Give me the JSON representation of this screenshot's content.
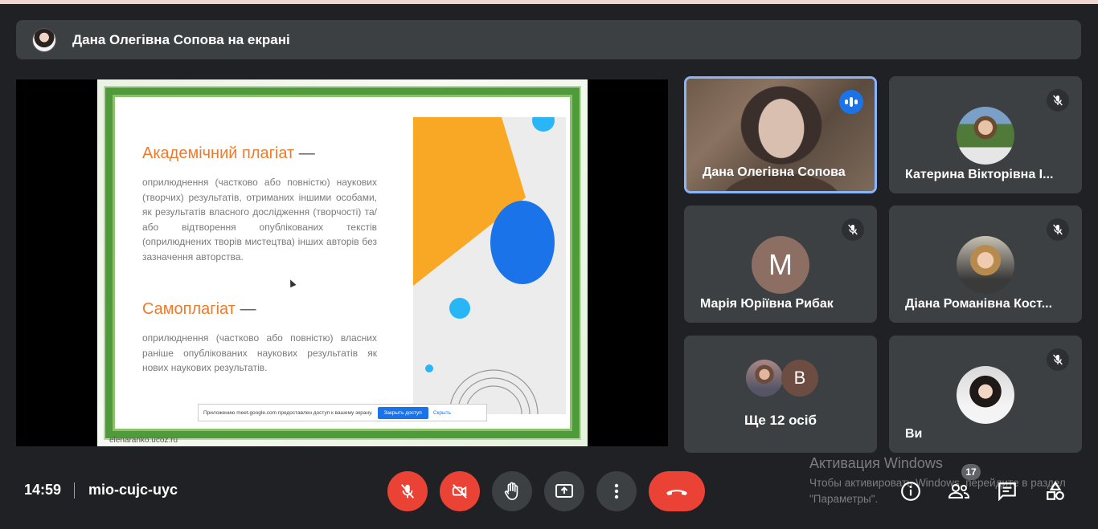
{
  "banner": {
    "title": "Дана Олегівна Сопова на екрані"
  },
  "slide": {
    "heading1": "Академічний плагіат",
    "heading_dash": "—",
    "text1": "оприлюднення (частково або повністю) наукових (творчих) результатів, отриманих іншими особами, як результатів власного дослідження (творчості) та/або відтворення опублікованих текстів (оприлюднених творів мистецтва) інших авторів без зазначення авторства.",
    "heading2": "Самоплагіат",
    "text2": "оприлюднення (частково або повністю) власних раніше опублікованих наукових результатів як нових наукових результатів.",
    "footer": "elenaranko.ucoz.ru",
    "share_notice": "Приложению meet.google.com предоставлен доступ к вашему экрану.",
    "share_stop": "Закрыть доступ",
    "share_hide": "Скрыть"
  },
  "participants": [
    {
      "name": "Дана Олегівна Сопова",
      "speaking": true
    },
    {
      "name": "Катерина Вікторівна І..."
    },
    {
      "name": "Марія Юріївна Рибак",
      "initial": "М"
    },
    {
      "name": "Діана Романівна Кост..."
    },
    {
      "more": "Ще 12 осіб",
      "initial": "В"
    },
    {
      "name": "Ви"
    }
  ],
  "footer": {
    "time": "14:59",
    "meeting_code": "mio-cujc-uyc",
    "people_count": "17"
  },
  "watermark": {
    "line1": "Активация Windows",
    "line2": "Чтобы активировать Windows, перейдите в раздел \"Параметры\"."
  },
  "colors": {
    "end_call": "#ea4335",
    "speaking": "#1a73e8",
    "active_border": "#8ab4f8"
  },
  "icons": [
    "mic-off-icon",
    "camera-off-icon",
    "raise-hand-icon",
    "present-icon",
    "more-vert-icon",
    "end-call-icon",
    "info-icon",
    "people-icon",
    "chat-icon",
    "activities-icon"
  ]
}
